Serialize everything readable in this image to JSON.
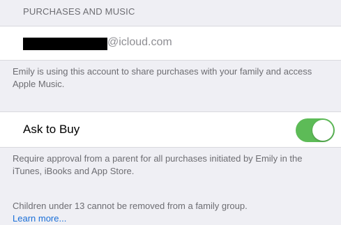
{
  "section": {
    "header": "PURCHASES AND MUSIC"
  },
  "email": {
    "domain": "@icloud.com"
  },
  "sharing_note": "Emily is using this account to share purchases with your family and access Apple Music.",
  "ask_to_buy": {
    "label": "Ask to Buy",
    "enabled": true,
    "note": "Require approval from a parent for all purchases initiated by Emily in the iTunes, iBooks and App Store."
  },
  "removal_note": {
    "text": "Children under 13 cannot be removed from a family group.",
    "link": "Learn more..."
  },
  "colors": {
    "toggle_on": "#5dbb57",
    "link": "#1a6fd8",
    "background": "#efeff4"
  }
}
